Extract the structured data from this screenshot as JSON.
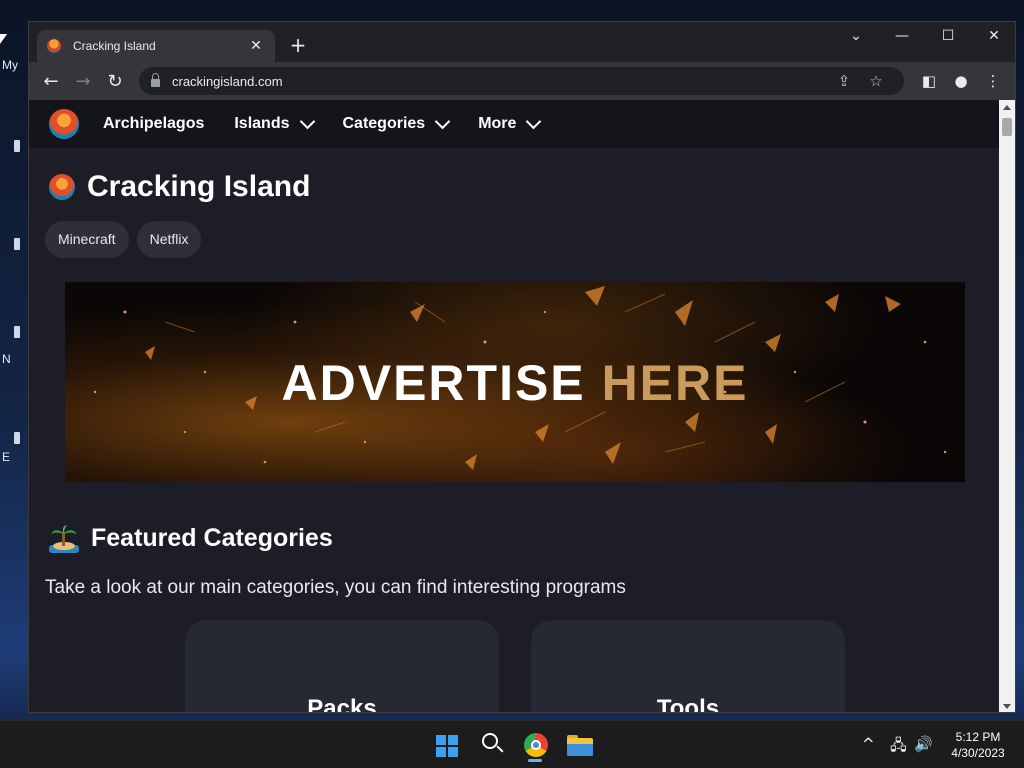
{
  "desktop": {
    "labels": [
      "My",
      "N",
      "E"
    ]
  },
  "browser": {
    "tab": {
      "title": "Cracking Island",
      "close_label": "✕"
    },
    "new_tab_label": "+",
    "window_controls": {
      "tabsearch": "⌄",
      "minimize": "—",
      "maximize": "☐",
      "close": "✕"
    },
    "nav": {
      "back": "←",
      "forward": "→",
      "reload": "↻"
    },
    "address_bar": {
      "url": "crackingisland.com"
    },
    "omnibox_icons": {
      "share": "⇪",
      "bookmark": "☆"
    },
    "toolbar_icons": {
      "sidebar": "◧",
      "profile": "●",
      "menu": "⋮"
    }
  },
  "site": {
    "nav": {
      "items": [
        {
          "label": "Archipelagos",
          "has_dropdown": false
        },
        {
          "label": "Islands",
          "has_dropdown": true
        },
        {
          "label": "Categories",
          "has_dropdown": true
        },
        {
          "label": "More",
          "has_dropdown": true
        }
      ]
    },
    "title": "Cracking Island",
    "chips": [
      "Minecraft",
      "Netflix"
    ],
    "banner": {
      "text_white": "ADVERTISE",
      "text_gold": "HERE"
    },
    "featured": {
      "title": "Featured Categories",
      "description": "Take a look at our main categories, you can find interesting programs",
      "cards": [
        {
          "label": "Packs"
        },
        {
          "label": "Tools"
        }
      ]
    }
  },
  "taskbar": {
    "apps": [
      "start",
      "search",
      "chrome",
      "file-explorer"
    ],
    "tray": {
      "chevron": "^",
      "network": "🖧",
      "volume": "🔊"
    },
    "clock": {
      "time": "5:12 PM",
      "date": "4/30/2023"
    }
  },
  "colors": {
    "page_bg": "#1c1d26",
    "nav_bg": "#14151b",
    "chip_bg": "#2e2f3a",
    "card_bg": "#262834",
    "gold": "#c99a5b",
    "browser_chrome": "#35363a"
  }
}
